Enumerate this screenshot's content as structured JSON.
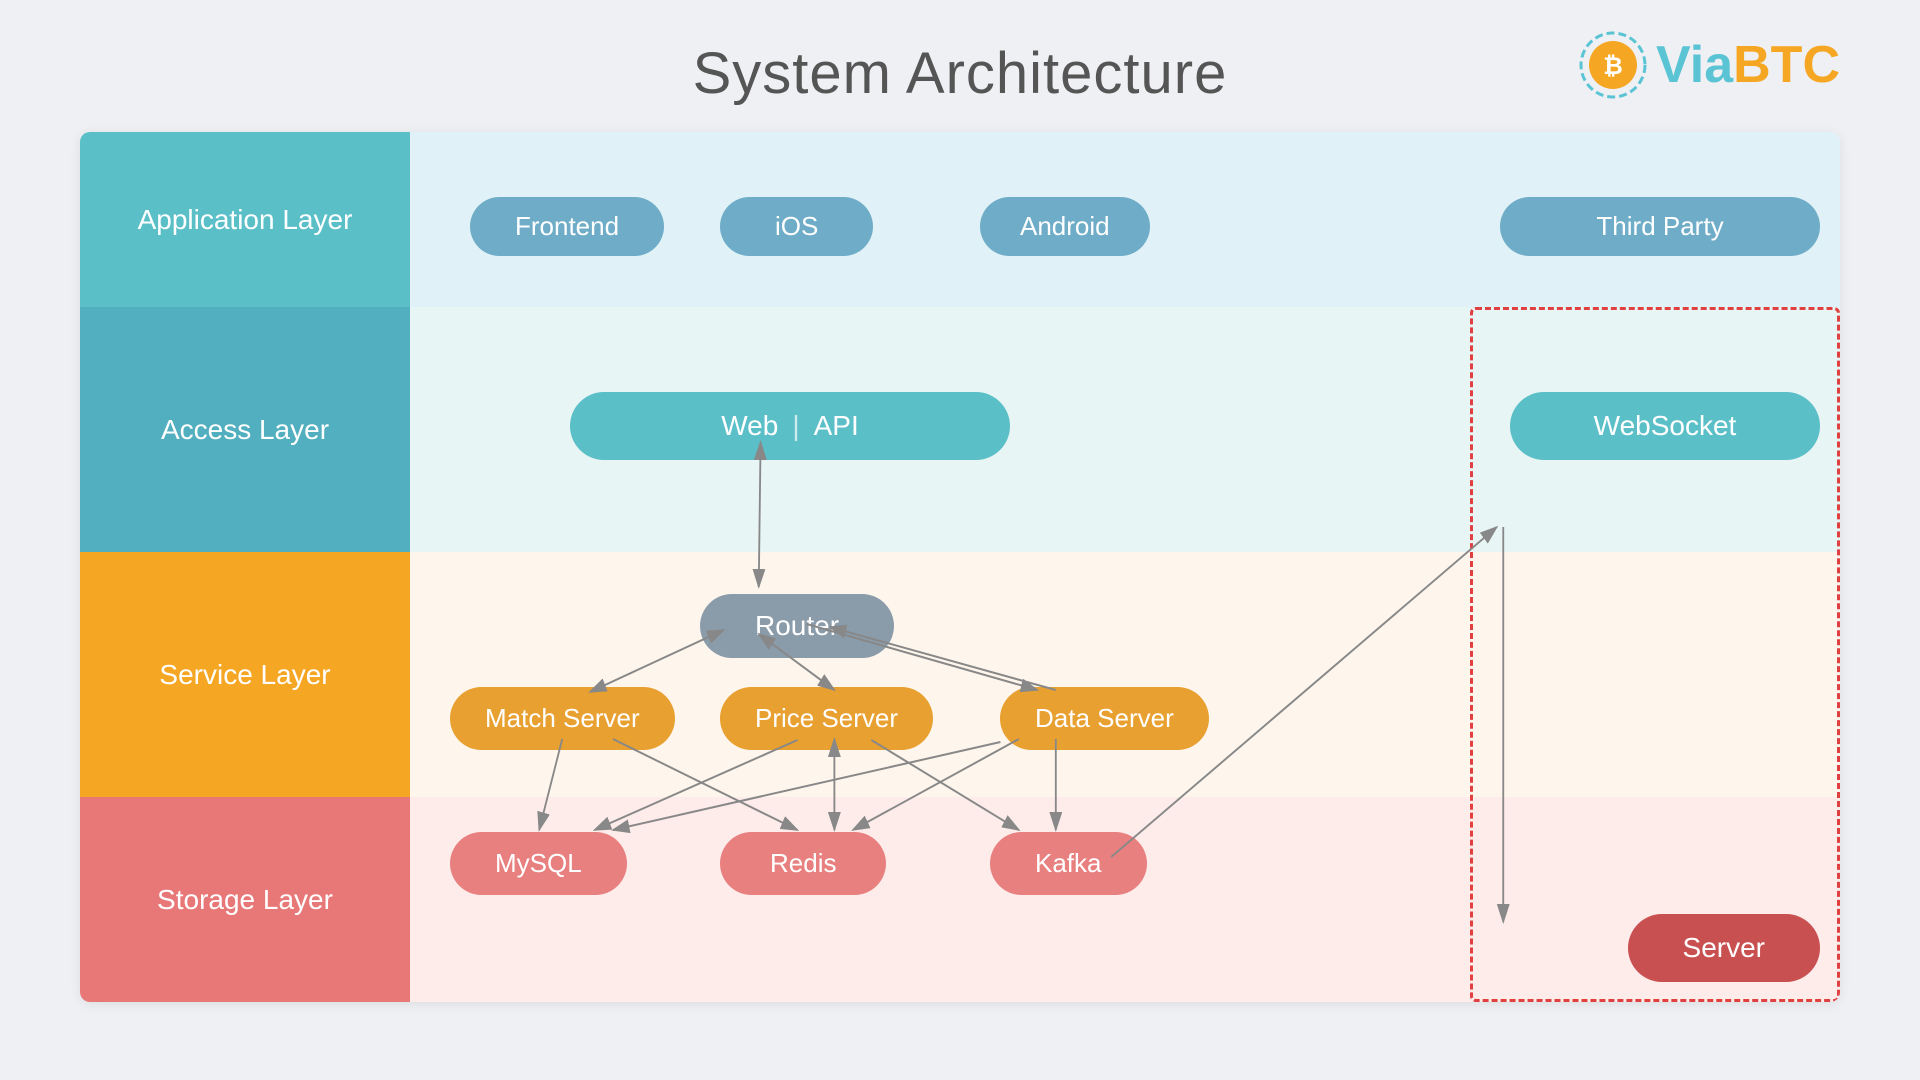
{
  "header": {
    "title": "System Architecture",
    "logo": {
      "via": "Via",
      "btc": "BTC",
      "icon_label": "bitcoin-circle-icon"
    }
  },
  "layers": {
    "application": {
      "label": "Application Layer"
    },
    "access": {
      "label": "Access Layer"
    },
    "service": {
      "label": "Service Layer"
    },
    "storage": {
      "label": "Storage Layer"
    }
  },
  "app_nodes": [
    {
      "id": "frontend",
      "label": "Frontend"
    },
    {
      "id": "ios",
      "label": "iOS"
    },
    {
      "id": "android",
      "label": "Android"
    },
    {
      "id": "third-party",
      "label": "Third Party"
    }
  ],
  "access_nodes": [
    {
      "id": "web-api",
      "label_left": "Web",
      "divider": "|",
      "label_right": "API"
    },
    {
      "id": "websocket",
      "label": "WebSocket"
    }
  ],
  "service_nodes": [
    {
      "id": "router",
      "label": "Router"
    },
    {
      "id": "match-server",
      "label": "Match Server"
    },
    {
      "id": "price-server",
      "label": "Price Server"
    },
    {
      "id": "data-server",
      "label": "Data Server"
    }
  ],
  "storage_nodes": [
    {
      "id": "mysql",
      "label": "MySQL"
    },
    {
      "id": "redis",
      "label": "Redis"
    },
    {
      "id": "kafka",
      "label": "Kafka"
    },
    {
      "id": "server",
      "label": "Server"
    }
  ]
}
